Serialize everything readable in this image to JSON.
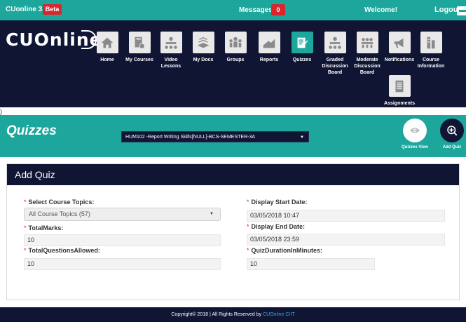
{
  "topbar": {
    "brand": "CUonline 3.0",
    "beta": "Beta",
    "messages_label": "Messages",
    "messages_count": "0",
    "welcome": "Welcome!",
    "logout": "Logout"
  },
  "logo": "CUOnline",
  "nav": [
    {
      "label": "Home",
      "icon": "home-icon"
    },
    {
      "label": "My Courses",
      "icon": "book-icon"
    },
    {
      "label": "Video Lessons",
      "icon": "video-lessons-icon"
    },
    {
      "label": "My Docs",
      "icon": "docs-icon"
    },
    {
      "label": "Groups",
      "icon": "groups-icon"
    },
    {
      "label": "Reports",
      "icon": "reports-icon"
    },
    {
      "label": "Quizzes",
      "icon": "quiz-icon"
    },
    {
      "label": "Graded Discussion Board",
      "icon": "graded-discussion-icon"
    },
    {
      "label": "Moderate Discussion Board",
      "icon": "moderate-discussion-icon"
    },
    {
      "label": "Notifications",
      "icon": "megaphone-icon"
    },
    {
      "label": "Course Information",
      "icon": "course-info-icon"
    },
    {
      "label": "Assignments",
      "icon": "assignments-icon"
    }
  ],
  "nav_active": "Quizzes",
  "stray_char": ")",
  "quizzes": {
    "title": "Quizzes",
    "course": "HUM102 -Report Writing Skills[NULL]-BCS-SEMESTER-3A",
    "view_label": "Quizzes View",
    "add_label": "Add Quiz"
  },
  "form": {
    "heading": "Add Quiz",
    "required_mark": "*",
    "course_topics_label": "Select Course Topics:",
    "course_topics_value": "All Course Topics (57)",
    "total_marks_label": "TotalMarks:",
    "total_marks_value": "10",
    "total_questions_label": "TotalQuestionsAllowed:",
    "total_questions_value": "10",
    "start_date_label": "Display Start Date:",
    "start_date_value": "03/05/2018 10:47",
    "end_date_label": "Display End Date:",
    "end_date_value": "03/05/2018 23:59",
    "duration_label": "QuizDurationInMinutes:",
    "duration_value": "10"
  },
  "footer": {
    "text": "Copyright© 2018 | All Rights Reserved by ",
    "link": "CUOnline CIIT"
  },
  "colors": {
    "teal": "#1da69b",
    "navy": "#0f1533",
    "badge_red": "#d9262e",
    "link_blue": "#3aa7e0"
  }
}
